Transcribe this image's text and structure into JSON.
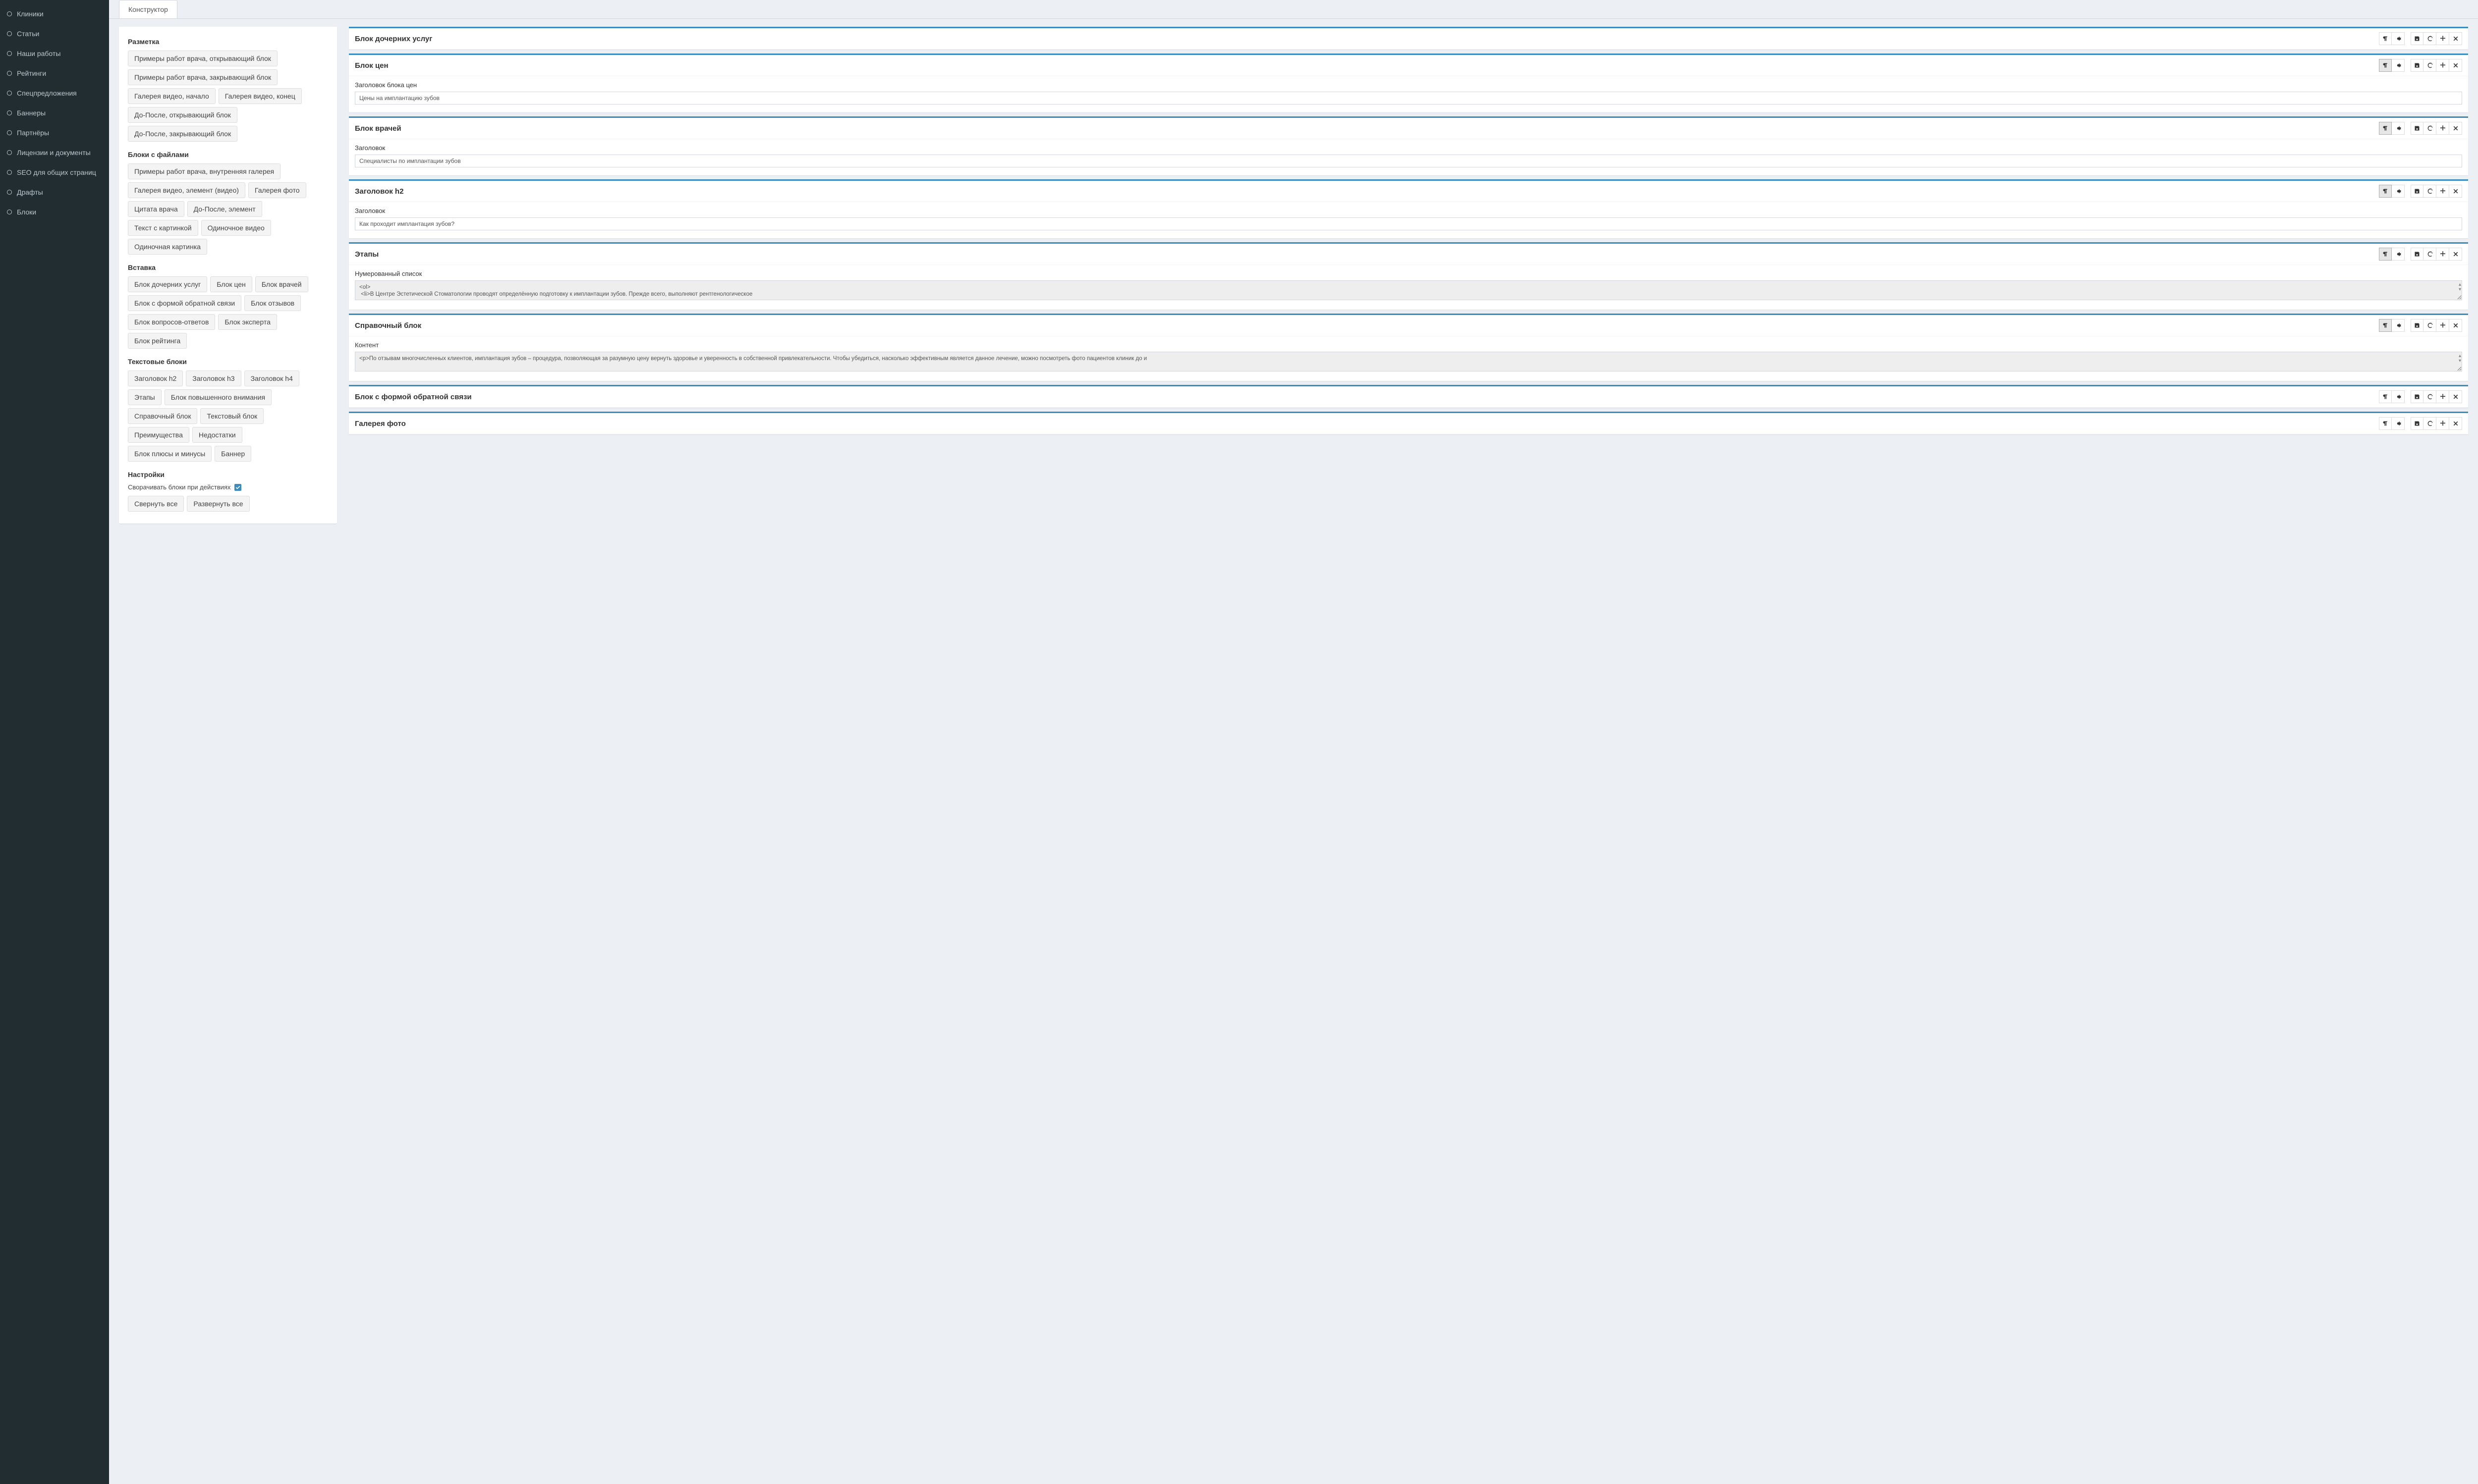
{
  "sidebar": [
    "Клиники",
    "Статьи",
    "Наши работы",
    "Рейтинги",
    "Спецпредложения",
    "Баннеры",
    "Партнёры",
    "Лицензии и документы",
    "SEO для общих страниц",
    "Драфты",
    "Блоки"
  ],
  "tab": "Конструктор",
  "palette": [
    {
      "title": "Разметка",
      "buttons": [
        "Примеры работ врача, открывающий блок",
        "Примеры работ врача, закрывающий блок",
        "Галерея видео, начало",
        "Галерея видео, конец",
        "До-После, открывающий блок",
        "До-После, закрывающий блок"
      ]
    },
    {
      "title": "Блоки с файлами",
      "buttons": [
        "Примеры работ врача, внутренняя галерея",
        "Галерея видео, элемент (видео)",
        "Галерея фото",
        "Цитата врача",
        "До-После, элемент",
        "Текст с картинкой",
        "Одиночное видео",
        "Одиночная картинка"
      ]
    },
    {
      "title": "Вставка",
      "buttons": [
        "Блок дочерних услуг",
        "Блок цен",
        "Блок врачей",
        "Блок с формой обратной связи",
        "Блок отзывов",
        "Блок вопросов-ответов",
        "Блок эксперта",
        "Блок рейтинга"
      ]
    },
    {
      "title": "Текстовые блоки",
      "buttons": [
        "Заголовок h2",
        "Заголовок h3",
        "Заголовок h4",
        "Этапы",
        "Блок повышенного внимания",
        "Справочный блок",
        "Текстовый блок",
        "Преимущества",
        "Недостатки",
        "Блок плюсы и минусы",
        "Баннер"
      ]
    }
  ],
  "settings_title": "Настройки",
  "settings_collapse_label": "Сворачивать блоки при действиях",
  "settings_collapse": true,
  "collapse_all": "Свернуть все",
  "expand_all": "Развернуть все",
  "blocks": [
    {
      "title": "Блок дочерних услуг",
      "toggled": false,
      "fields": []
    },
    {
      "title": "Блок цен",
      "toggled": true,
      "fields": [
        {
          "label": "Заголовок блока цен",
          "type": "text",
          "value": "Цены на имплантацию зубов"
        }
      ]
    },
    {
      "title": "Блок врачей",
      "toggled": true,
      "fields": [
        {
          "label": "Заголовок",
          "type": "text",
          "value": "Специалисты по имплантации зубов"
        }
      ]
    },
    {
      "title": "Заголовок h2",
      "toggled": true,
      "fields": [
        {
          "label": "Заголовок",
          "type": "text",
          "value": "Как проходит имплантация зубов?"
        }
      ]
    },
    {
      "title": "Этапы",
      "toggled": true,
      "fields": [
        {
          "label": "Нумерованный список",
          "type": "textarea",
          "value": "<ol>\n <li>В Центре Эстетической Стоматологии проводят определённую подготовку к имплантации зубов. Прежде всего, выполняют рентгенологическое"
        }
      ]
    },
    {
      "title": "Справочный блок",
      "toggled": true,
      "fields": [
        {
          "label": "Контент",
          "type": "textarea",
          "value": "<p>По отзывам многочисленных клиентов, имплантация зубов &ndash; процедура, позволяющая за разумную цену вернуть здоровье и уверенность в собственной привлекательности. Чтобы убедиться, насколько эффективным является данное лечение, можно посмотреть фото пациентов клиник до и"
        }
      ]
    },
    {
      "title": "Блок с формой обратной связи",
      "toggled": false,
      "fields": []
    },
    {
      "title": "Галерея фото",
      "toggled": false,
      "fields": []
    }
  ]
}
